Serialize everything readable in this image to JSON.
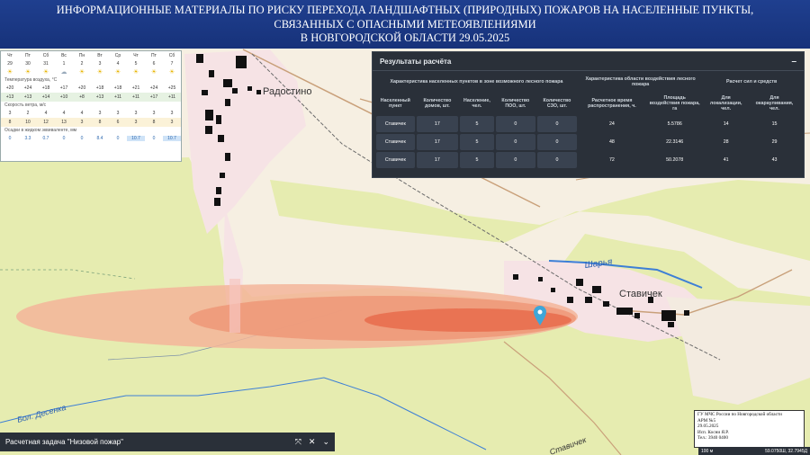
{
  "banner": {
    "line1": "ИНФОРМАЦИОННЫЕ МАТЕРИАЛЫ ПО РИСКУ ПЕРЕХОДА ЛАНДШАФТНЫХ (ПРИРОДНЫХ) ПОЖАРОВ НА НАСЕЛЕННЫЕ ПУНКТЫ,",
    "line2": "СВЯЗАННЫХ С ОПАСНЫМИ МЕТЕОЯВЛЕНИЯМИ",
    "line3": "В НОВГОРОДСКОЙ ОБЛАСТИ 29.05.2025"
  },
  "map": {
    "labels": {
      "radostino": "Радостино",
      "stavichek": "Ставичек",
      "sharya": "Шарья",
      "desenka": "Бол. Десенка",
      "stavichek_road": "Ставичек"
    },
    "colors": {
      "forest": "#e6ecb0",
      "settlement": "#f6e7e7",
      "fire_outer": "#f3b59a",
      "fire_mid": "#ee9878",
      "fire_core": "#e86f4f",
      "water": "#3d7fd6",
      "marker": "#3fa6d8"
    }
  },
  "weather": {
    "days": [
      "Чт",
      "Пт",
      "Сб",
      "Вс",
      "Пн",
      "Вт",
      "Ср",
      "Чт",
      "Пт",
      "Сб"
    ],
    "dates": [
      "29",
      "30",
      "31",
      "1",
      "2",
      "3",
      "4",
      "5",
      "6",
      "7"
    ],
    "temp_label": "Температура воздуха, °C",
    "day_temps": [
      "+20",
      "+24",
      "+18",
      "+17",
      "+20",
      "+18",
      "+18",
      "+21",
      "+24",
      "+25"
    ],
    "night_temps": [
      "+13",
      "+13",
      "+14",
      "+10",
      "+8",
      "+13",
      "+11",
      "+11",
      "+17",
      "+11"
    ],
    "wind_label": "Скорость ветра, м/с",
    "wind": [
      "3",
      "2",
      "4",
      "4",
      "4",
      "3",
      "3",
      "3",
      "3",
      "3"
    ],
    "gust": [
      "8",
      "10",
      "12",
      "13",
      "3",
      "8",
      "6",
      "3",
      "8",
      "3"
    ],
    "precip_label": "Осадки в жидком эквиваленте, мм",
    "precip": [
      "0",
      "3.3",
      "0.7",
      "0",
      "0",
      "8.4",
      "0",
      "10.7",
      "0",
      "10.7"
    ]
  },
  "results": {
    "title": "Результаты расчёта",
    "collapse": "–",
    "groups": [
      "Характеристика населенных пунктов в зоне возможного лесного пожара",
      "Характеристика области воздействия лесного пожара",
      "Расчет сил и средств"
    ],
    "columns": [
      "Населенный пункт",
      "Количество домов, шт.",
      "Население, чел.",
      "Количество ПОО, шт.",
      "Количество СЗО, шт.",
      "Расчетное время распространения, ч.",
      "Площадь воздействия пожара, га",
      "Для локализации, чел.",
      "Для окарауливания, чел."
    ],
    "rows": [
      [
        "Ставичек",
        "17",
        "5",
        "0",
        "0",
        "24",
        "5.5786",
        "14",
        "15"
      ],
      [
        "Ставичек",
        "17",
        "5",
        "0",
        "0",
        "48",
        "22.3146",
        "28",
        "29"
      ],
      [
        "Ставичек",
        "17",
        "5",
        "0",
        "0",
        "72",
        "50.2078",
        "41",
        "43"
      ]
    ]
  },
  "taskbar": {
    "title": "Расчетная задача \"Низовой пожар\"",
    "icons": [
      "expand-icon",
      "close-icon",
      "chevron-down-icon"
    ]
  },
  "stamp": {
    "line1": "ГУ МЧС России по Новгородской области",
    "line2": "АРМ №5",
    "line3": "29.05.2025",
    "line4": "Исп. Косни Я.Р.",
    "line5": "Тел.: 3940 0400"
  },
  "scale": {
    "value": "100 м",
    "coords": "59.0750Ш, 32.7945Д"
  }
}
